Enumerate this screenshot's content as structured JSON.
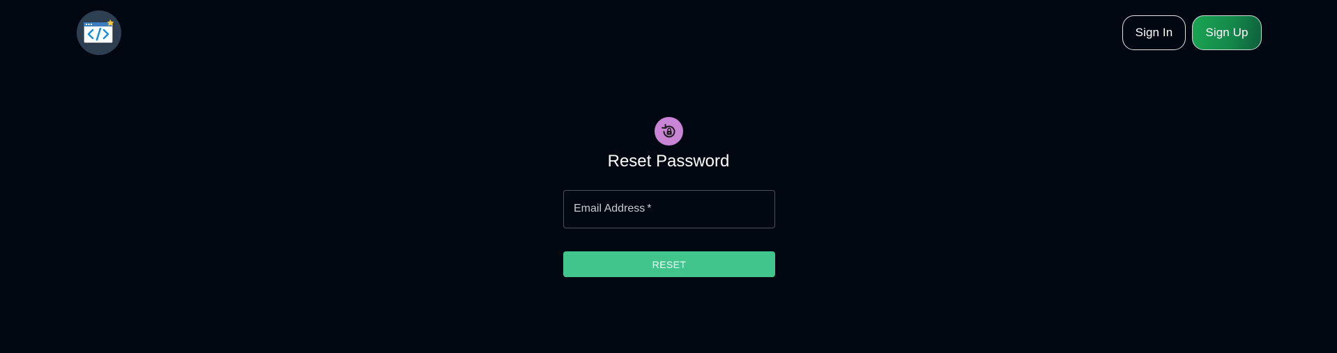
{
  "header": {
    "logo_icon": "code-window-icon",
    "signin_label": "Sign In",
    "signup_label": "Sign Up"
  },
  "form": {
    "icon": "lock-reset-icon",
    "title": "Reset Password",
    "email": {
      "label": "Email Address",
      "required_mark": "*",
      "value": ""
    },
    "submit_label": "RESET"
  },
  "colors": {
    "background": "#020812",
    "accent_green": "#41c58d",
    "icon_circle": "#c984d6",
    "logo_circle": "#2f3f52"
  }
}
